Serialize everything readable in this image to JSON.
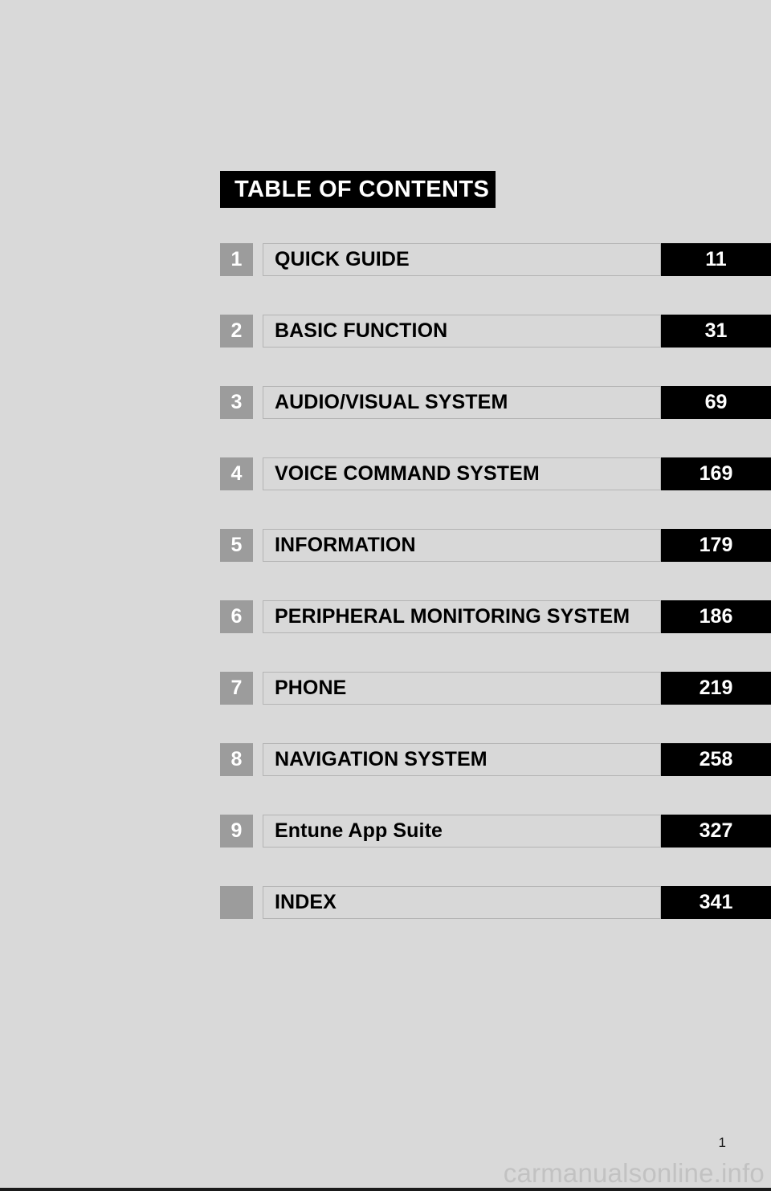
{
  "document": {
    "heading": "TABLE OF CONTENTS",
    "folio": "1",
    "watermark": "carmanualsonline.info"
  },
  "colors": {
    "page_background": "#d9d9d9",
    "heading_background": "#000000",
    "heading_text": "#ffffff",
    "chip_background": "#9c9c9c",
    "chip_text": "#ffffff",
    "label_box_background": "#d8d8d8",
    "label_box_border": "#b4b4b4",
    "label_text": "#000000",
    "page_number_background": "#000000",
    "page_number_text": "#ffffff",
    "watermark_text": "#c2c2c2"
  },
  "toc": {
    "entries": [
      {
        "chapter": "1",
        "title": "QUICK GUIDE",
        "page": "11"
      },
      {
        "chapter": "2",
        "title": "BASIC FUNCTION",
        "page": "31"
      },
      {
        "chapter": "3",
        "title": "AUDIO/VISUAL SYSTEM",
        "page": "69"
      },
      {
        "chapter": "4",
        "title": "VOICE COMMAND SYSTEM",
        "page": "169"
      },
      {
        "chapter": "5",
        "title": "INFORMATION",
        "page": "179"
      },
      {
        "chapter": "6",
        "title": "PERIPHERAL MONITORING SYSTEM",
        "page": "186"
      },
      {
        "chapter": "7",
        "title": "PHONE",
        "page": "219"
      },
      {
        "chapter": "8",
        "title": "NAVIGATION SYSTEM",
        "page": "258"
      },
      {
        "chapter": "9",
        "title": "Entune App Suite",
        "page": "327"
      },
      {
        "chapter": "",
        "title": "INDEX",
        "page": "341"
      }
    ]
  }
}
